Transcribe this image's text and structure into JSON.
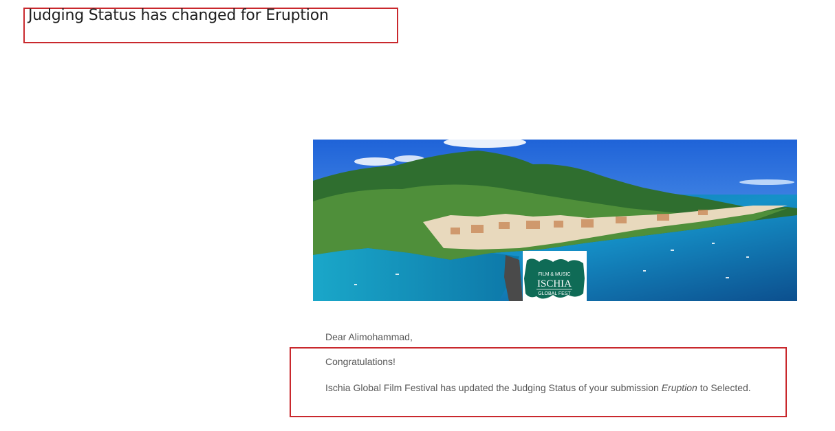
{
  "email": {
    "subject": "Judging Status has changed for Eruption",
    "greeting": "Dear Alimohammad,",
    "congrats": "Congratulations!",
    "message_prefix": "Ischia Global Film Festival has updated the Judging Status of your submission ",
    "submission_title": "Eruption",
    "message_suffix": " to Selected."
  },
  "logo": {
    "line1": "FILM & MUSIC",
    "line2": "ISCHIA",
    "line3": "GLOBAL FEST"
  },
  "colors": {
    "highlight_border": "#c9282d",
    "logo_green": "#0f6b56",
    "text": "#555555"
  }
}
